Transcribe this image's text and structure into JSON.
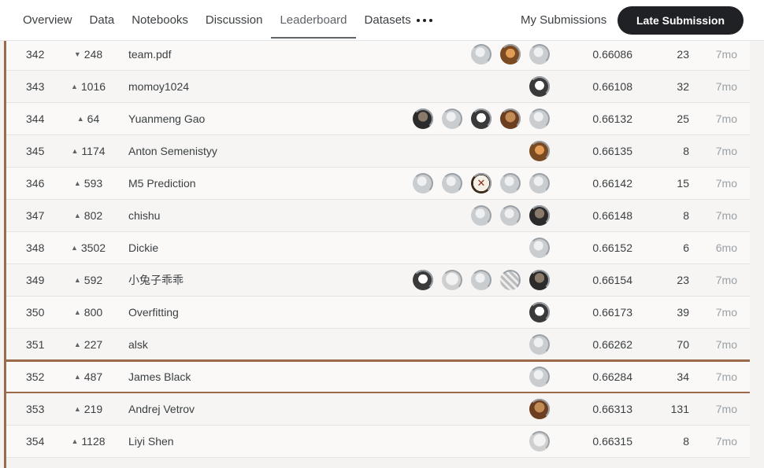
{
  "tabs": [
    {
      "label": "Overview",
      "active": false
    },
    {
      "label": "Data",
      "active": false
    },
    {
      "label": "Notebooks",
      "active": false
    },
    {
      "label": "Discussion",
      "active": false
    },
    {
      "label": "Leaderboard",
      "active": true
    },
    {
      "label": "Datasets",
      "active": false
    }
  ],
  "more_icon": "more-horizontal-icon",
  "my_submissions": "My Submissions",
  "late_submission": "Late Submission",
  "colors": {
    "highlight_border": "#9a6a4a",
    "button_bg": "#202124",
    "row_bg": "#faf9f7"
  },
  "leaderboard": {
    "rows": [
      {
        "rank": "342",
        "dir": "down",
        "delta": "248",
        "team": "team.pdf",
        "avatars": [
          "def",
          "orange",
          "def"
        ],
        "score": "0.66086",
        "entries": "23",
        "last": "7mo"
      },
      {
        "rank": "343",
        "dir": "up",
        "delta": "1016",
        "team": "momoy1024",
        "avatars": [
          "mono"
        ],
        "score": "0.66108",
        "entries": "32",
        "last": "7mo"
      },
      {
        "rank": "344",
        "dir": "up",
        "delta": "64",
        "team": "Yuanmeng Gao",
        "avatars": [
          "dark",
          "def",
          "mono",
          "brown",
          "def"
        ],
        "score": "0.66132",
        "entries": "25",
        "last": "7mo"
      },
      {
        "rank": "345",
        "dir": "up",
        "delta": "1174",
        "team": "Anton Semenistyy",
        "avatars": [
          "orange"
        ],
        "score": "0.66135",
        "entries": "8",
        "last": "7mo"
      },
      {
        "rank": "346",
        "dir": "up",
        "delta": "593",
        "team": "M5 Prediction",
        "avatars": [
          "def",
          "def",
          "cross",
          "def",
          "def"
        ],
        "score": "0.66142",
        "entries": "15",
        "last": "7mo"
      },
      {
        "rank": "347",
        "dir": "up",
        "delta": "802",
        "team": "chishu",
        "avatars": [
          "def",
          "def",
          "dark"
        ],
        "score": "0.66148",
        "entries": "8",
        "last": "7mo"
      },
      {
        "rank": "348",
        "dir": "up",
        "delta": "3502",
        "team": "Dickie",
        "avatars": [
          "def"
        ],
        "score": "0.66152",
        "entries": "6",
        "last": "6mo"
      },
      {
        "rank": "349",
        "dir": "up",
        "delta": "592",
        "team": "小兔子乖乖",
        "avatars": [
          "mono",
          "light",
          "def",
          "pattern",
          "dark"
        ],
        "score": "0.66154",
        "entries": "23",
        "last": "7mo"
      },
      {
        "rank": "350",
        "dir": "up",
        "delta": "800",
        "team": "Overfitting",
        "avatars": [
          "mono"
        ],
        "score": "0.66173",
        "entries": "39",
        "last": "7mo"
      },
      {
        "rank": "351",
        "dir": "up",
        "delta": "227",
        "team": "alsk",
        "avatars": [
          "def"
        ],
        "score": "0.66262",
        "entries": "70",
        "last": "7mo"
      },
      {
        "rank": "352",
        "dir": "up",
        "delta": "487",
        "team": "James Black",
        "avatars": [
          "def"
        ],
        "score": "0.66284",
        "entries": "34",
        "last": "7mo",
        "highlight": true
      },
      {
        "rank": "353",
        "dir": "up",
        "delta": "219",
        "team": "Andrej Vetrov",
        "avatars": [
          "brown"
        ],
        "score": "0.66313",
        "entries": "131",
        "last": "7mo"
      },
      {
        "rank": "354",
        "dir": "up",
        "delta": "1128",
        "team": "Liyi Shen",
        "avatars": [
          "light"
        ],
        "score": "0.66315",
        "entries": "8",
        "last": "7mo"
      }
    ]
  }
}
